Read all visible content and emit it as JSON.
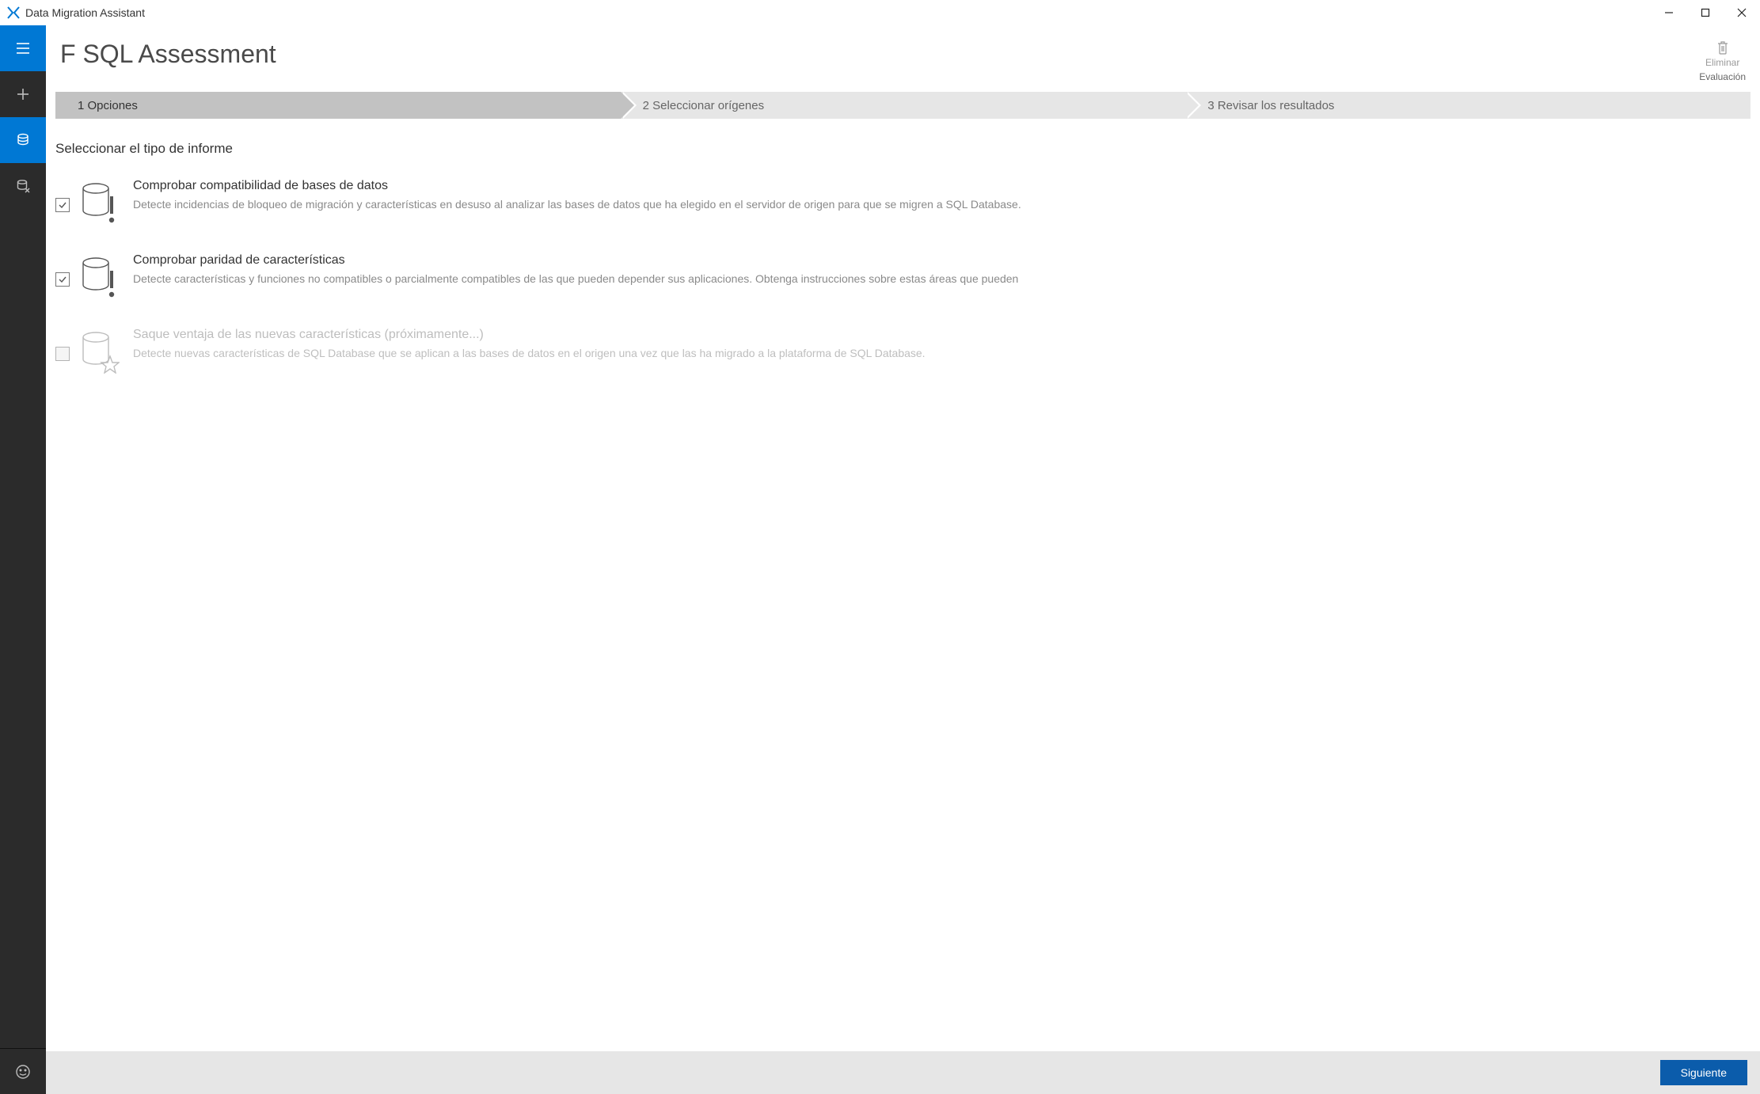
{
  "app": {
    "title": "Data Migration Assistant"
  },
  "header": {
    "page_title": "F SQL Assessment",
    "delete_label": "Eliminar",
    "eval_label": "Evaluación"
  },
  "steps": {
    "s1": "1 Opciones",
    "s2": "2 Seleccionar orígenes",
    "s3": "3 Revisar los resultados"
  },
  "content": {
    "section_title": "Seleccionar el tipo de informe",
    "options": [
      {
        "title": "Comprobar compatibilidad de bases de datos",
        "desc": "Detecte incidencias de bloqueo de migración y características en desuso al analizar las bases de datos que ha elegido en el servidor de origen para que se migren a SQL Database."
      },
      {
        "title": "Comprobar paridad de características",
        "desc": "Detecte características y funciones no compatibles o parcialmente compatibles de las que pueden depender sus aplicaciones. Obtenga instrucciones sobre estas áreas que pueden"
      },
      {
        "title": "Saque ventaja de las nuevas características (próximamente...)",
        "desc": "Detecte nuevas características de SQL Database que se aplican a las bases de datos en el origen una vez que las ha migrado a la plataforma de SQL Database."
      }
    ]
  },
  "footer": {
    "next_label": "Siguiente"
  }
}
